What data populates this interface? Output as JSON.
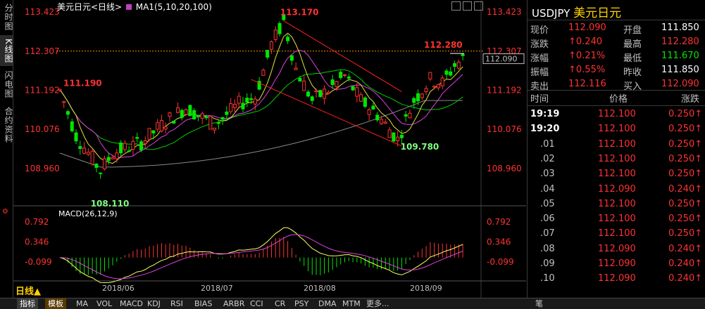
{
  "left_tabs": [
    {
      "label": "分时图",
      "active": false
    },
    {
      "label": "K线图",
      "active": true
    },
    {
      "label": "闪电图",
      "active": false
    },
    {
      "label": "合约资料",
      "active": false
    }
  ],
  "kline_header": {
    "title": "美元日元<日线>",
    "ma_label": "MA1(5,10,20,100)"
  },
  "macd_header": "MACD(26,12,9)",
  "period": "日线▲",
  "price_axis": [
    "113.423",
    "112.307",
    "111.192",
    "110.076",
    "108.960"
  ],
  "macd_axis": [
    "0.792",
    "0.346",
    "-0.099"
  ],
  "current_price_tag": "112.090",
  "date_labels": [
    "2018/06",
    "2018/07",
    "2018/08",
    "2018/09"
  ],
  "annotations": {
    "high": "113.170",
    "low": "109.780",
    "recent_high": "112.280",
    "left_high": "111.190",
    "left_low": "108.110"
  },
  "bottom_tabs": [
    "指标",
    "模板",
    "MA",
    "VOL",
    "MACD",
    "KDJ",
    "RSI",
    "BIAS",
    "ARBR",
    "CCI",
    "CR",
    "PSY",
    "DMA",
    "MTM",
    "更多..."
  ],
  "right_panel": {
    "code": "USDJPY",
    "name": "美元日元",
    "quote": [
      {
        "l1": "现价",
        "v1": "112.090",
        "c1": "up",
        "l2": "开盘",
        "v2": "111.850",
        "c2": "wh"
      },
      {
        "l1": "涨跌",
        "v1": "↑0.240",
        "c1": "up",
        "l2": "最高",
        "v2": "112.280",
        "c2": "up"
      },
      {
        "l1": "涨幅",
        "v1": "↑0.21%",
        "c1": "up",
        "l2": "最低",
        "v2": "111.670",
        "c2": "dn"
      },
      {
        "l1": "振幅",
        "v1": "↑0.55%",
        "c1": "up",
        "l2": "昨收",
        "v2": "111.850",
        "c2": "wh"
      },
      {
        "l1": "卖出",
        "v1": "112.116",
        "c1": "up",
        "l2": "买入",
        "v2": "112.090",
        "c2": "up"
      }
    ],
    "tick_header": {
      "time": "时间",
      "price": "价格",
      "change": "涨跌"
    },
    "ticks": [
      {
        "time": "19:19",
        "price": "112.100",
        "change": "0.250↑"
      },
      {
        "time": "19:20",
        "price": "112.100",
        "change": "0.250↑"
      },
      {
        "time": ".01",
        "price": "112.100",
        "change": "0.250↑"
      },
      {
        "time": ".02",
        "price": "112.100",
        "change": "0.250↑"
      },
      {
        "time": ".03",
        "price": "112.100",
        "change": "0.250↑"
      },
      {
        "time": ".04",
        "price": "112.090",
        "change": "0.240↑"
      },
      {
        "time": ".05",
        "price": "112.100",
        "change": "0.250↑"
      },
      {
        "time": ".06",
        "price": "112.100",
        "change": "0.250↑"
      },
      {
        "time": ".07",
        "price": "112.100",
        "change": "0.250↑"
      },
      {
        "time": ".08",
        "price": "112.090",
        "change": "0.240↑"
      },
      {
        "time": ".09",
        "price": "112.090",
        "change": "0.240↑"
      },
      {
        "time": ".10",
        "price": "112.090",
        "change": "0.240↑"
      }
    ],
    "footer_label": "笔"
  },
  "colors": {
    "up": "#ff3232",
    "down": "#00e600",
    "accent": "#ffd200"
  }
}
